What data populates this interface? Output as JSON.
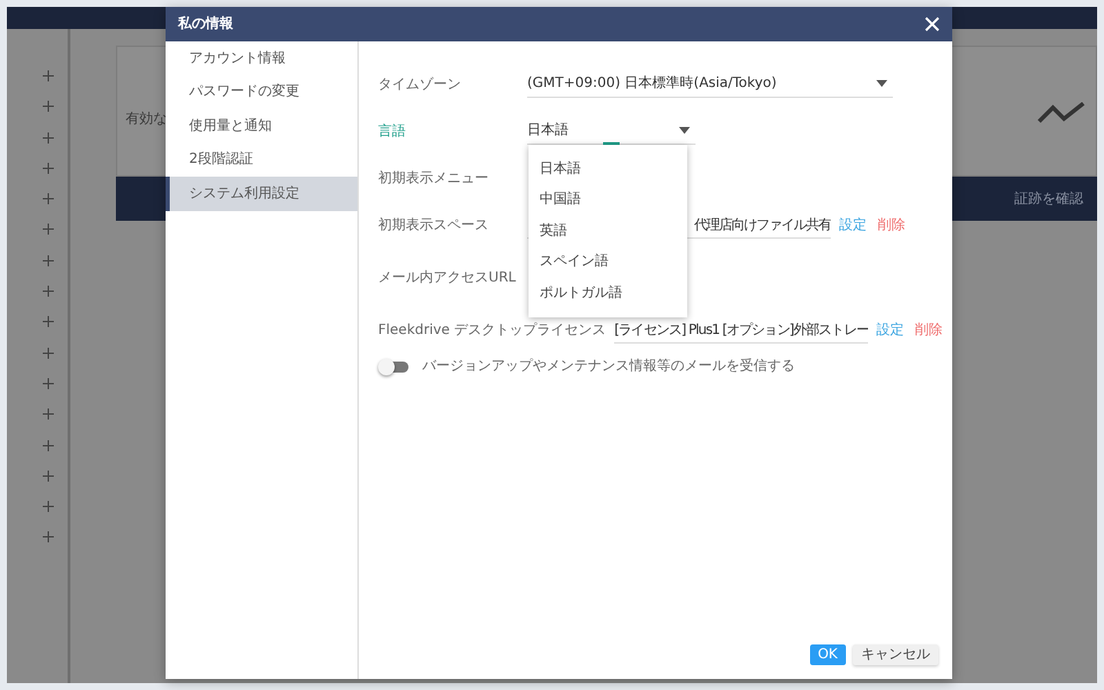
{
  "background": {
    "card_text": "有効な",
    "banner_text": "証跡を確認"
  },
  "modal": {
    "title": "私の情報",
    "nav": [
      {
        "label": "アカウント情報",
        "selected": false
      },
      {
        "label": "パスワードの変更",
        "selected": false
      },
      {
        "label": "使用量と通知",
        "selected": false
      },
      {
        "label": "2段階認証",
        "selected": false
      },
      {
        "label": "システム利用設定",
        "selected": true
      }
    ],
    "fields": [
      {
        "kind": "select",
        "label": "タイムゾーン",
        "value": "(GMT+09:00) 日本標準時(Asia/Tokyo)",
        "focused": false
      },
      {
        "kind": "select",
        "label": "言語",
        "value": "日本語",
        "focused": true,
        "open": true,
        "options": [
          "日本語",
          "中国語",
          "英語",
          "スペイン語",
          "ポルトガル語"
        ]
      },
      {
        "kind": "blank",
        "label": "初期表示メニュー",
        "focused": false
      },
      {
        "kind": "text",
        "label": "初期表示スペース",
        "value": "代理店向けファイル共有",
        "focused": false,
        "links": [
          {
            "label": "設定",
            "kind": "set"
          },
          {
            "label": "削除",
            "kind": "delete"
          }
        ]
      },
      {
        "kind": "blank",
        "label": "メール内アクセスURL",
        "focused": false
      },
      {
        "kind": "text",
        "label": "Fleekdrive デスクトップライセンス",
        "value": "[ライセンス] Plus1 [オプション]外部ストレー",
        "focused": false,
        "links": [
          {
            "label": "設定",
            "kind": "set"
          },
          {
            "label": "削除",
            "kind": "delete"
          }
        ]
      }
    ],
    "toggle": {
      "label": "バージョンアップやメンテナンス情報等のメールを受信する",
      "on": false
    },
    "buttons": [
      {
        "label": "OK",
        "kind": "primary"
      },
      {
        "label": "キャンセル",
        "kind": "secondary"
      }
    ]
  }
}
